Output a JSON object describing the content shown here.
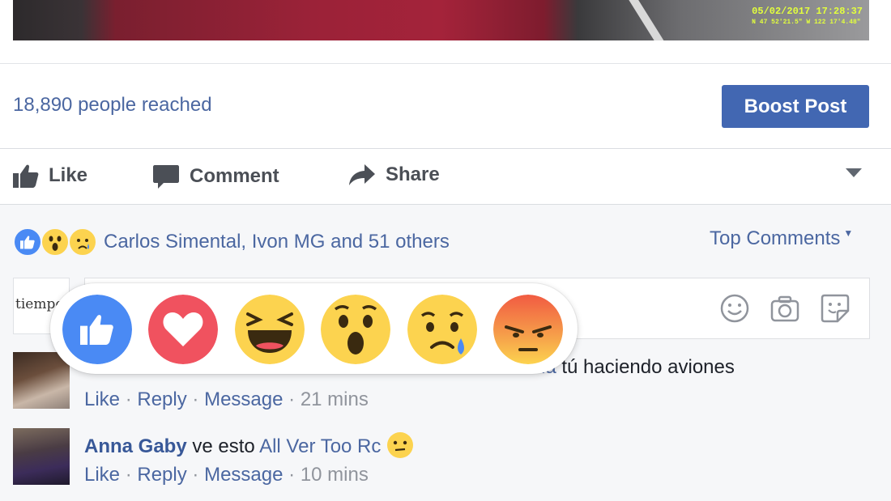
{
  "photo": {
    "timestamp": "05/02/2017 17:28:37",
    "coords": "N 47 52'21.5\" W 122 17'4.48\""
  },
  "post": {
    "reach_text": "18,890 people reached",
    "boost_label": "Boost Post"
  },
  "actions": {
    "like": "Like",
    "comment": "Comment",
    "share": "Share"
  },
  "reactions_summary": {
    "icons": [
      "like-reaction-icon",
      "wow-reaction-icon",
      "sad-reaction-icon"
    ],
    "names": "Carlos Simental, Ivon MG and 51 others",
    "sort_label": "Top Comments"
  },
  "composer": {
    "avatar_text": "tiempo",
    "icons": [
      "emoji-icon",
      "camera-icon",
      "sticker-icon"
    ]
  },
  "reaction_picker": [
    "like",
    "love",
    "haha",
    "wow",
    "sad",
    "angry"
  ],
  "comments": [
    {
      "name_partial": "",
      "text_start": "da",
      "text_end": " tú haciendo aviones",
      "like": "Like",
      "reply": "Reply",
      "message": "Message",
      "sep": "·",
      "time": "21 mins"
    },
    {
      "name": "Anna Gaby",
      "text_pre": " ve esto ",
      "mention": "All Ver Too Rc",
      "like": "Like",
      "reply": "Reply",
      "message": "Message",
      "sep": "·",
      "time": "10 mins"
    }
  ],
  "colors": {
    "brand": "#4267b2",
    "link": "#4b67a1",
    "bg_grey": "#f6f7f9",
    "love": "#f0525f",
    "angry_top": "#f15b42",
    "emoji_yellow": "#fcd34f"
  }
}
